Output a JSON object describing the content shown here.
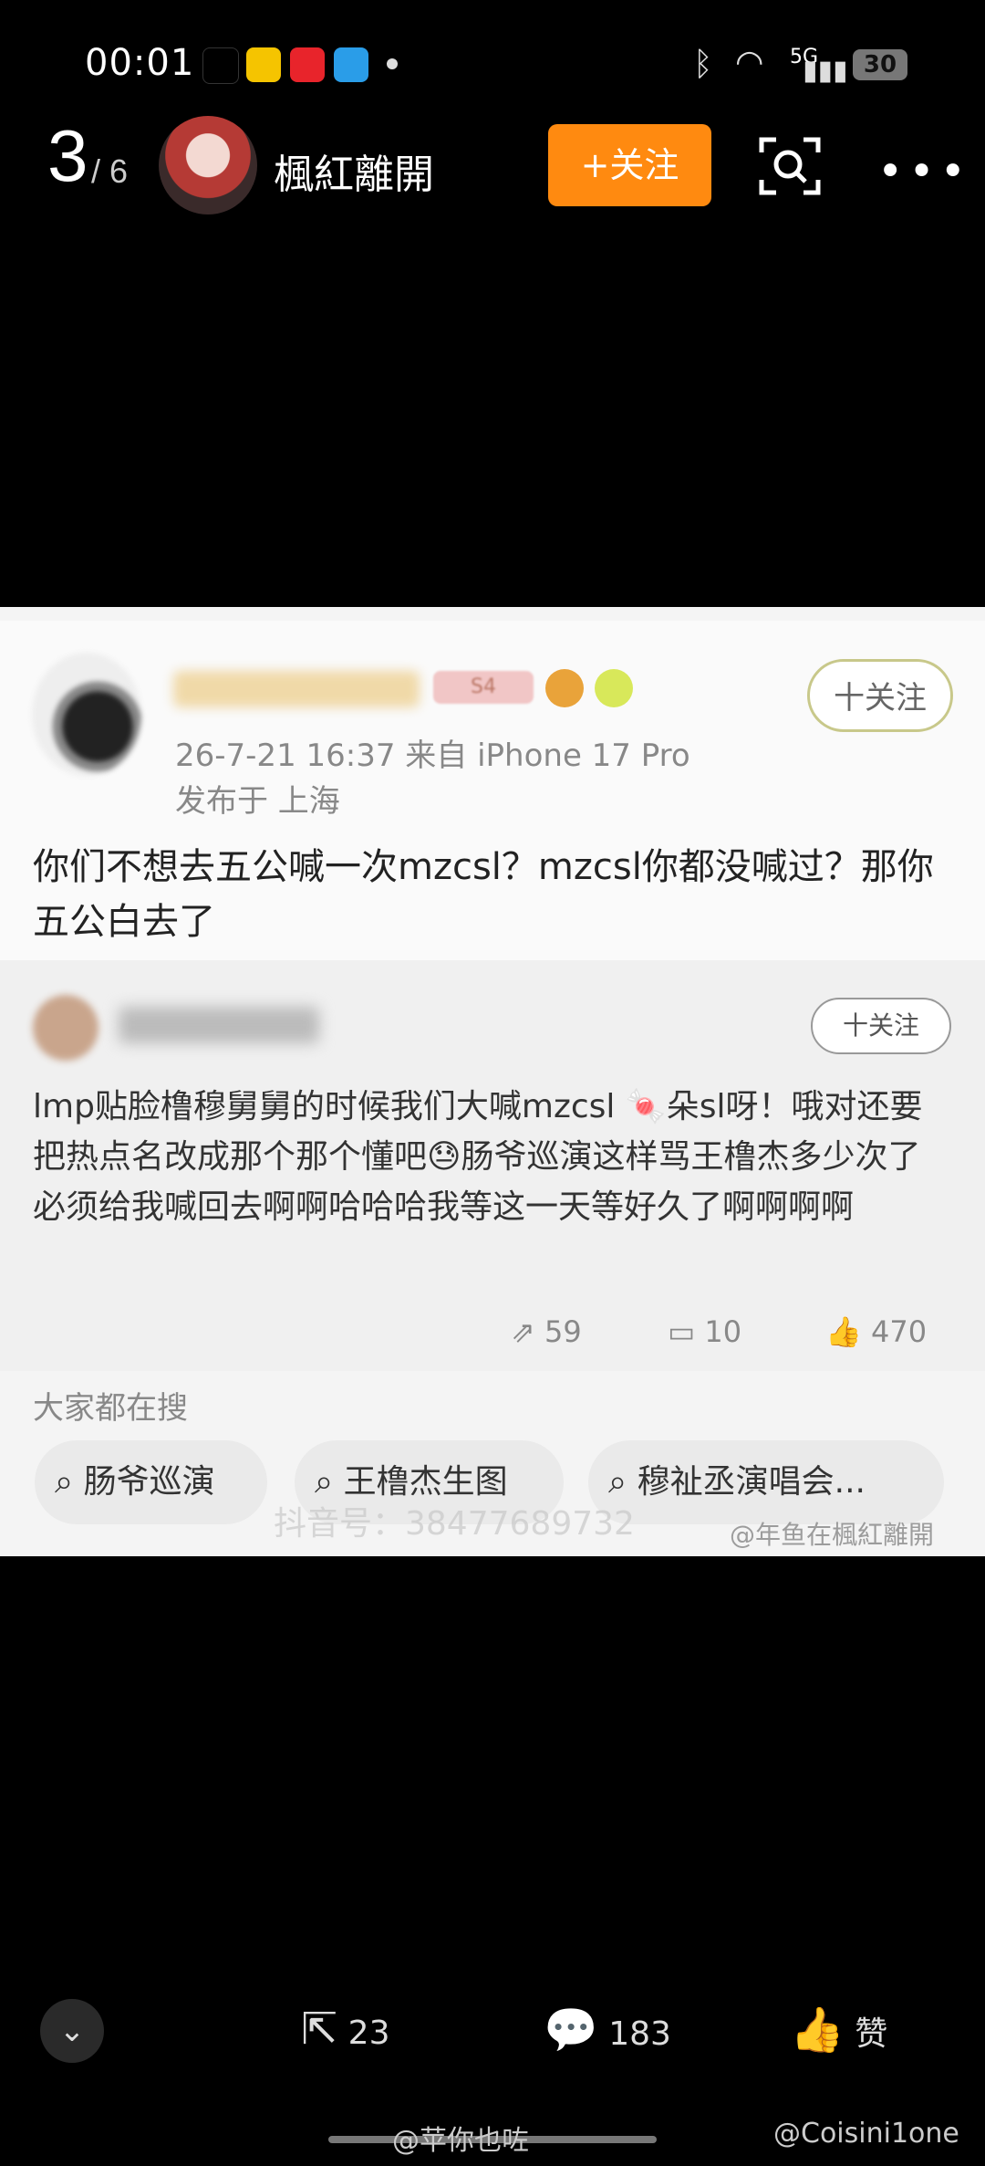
{
  "status_bar": {
    "time": "00:01",
    "network": "5G",
    "battery": "30"
  },
  "header": {
    "page_current": "3",
    "page_total": "/ 6",
    "author": "楓紅離開",
    "follow_label": "+关注"
  },
  "post": {
    "meta_line1": "26-7-21 16:37  来自 iPhone 17 Pro",
    "meta_line2": "发布于 上海",
    "follow_label": "十关注",
    "text": "你们不想去五公喊一次mzcsl？mzcsl你都没喊过？那你五公白去了",
    "badge": "S4"
  },
  "reply": {
    "follow_label": "十关注",
    "text": "lmp贴脸橹穆舅舅的时候我们大喊mzcsl 🍬朵sl呀！哦对还要把热点名改成那个那个懂吧😓肠爷巡演这样骂王橹杰多少次了 必须给我喊回去啊啊哈哈哈我等这一天等好久了啊啊啊啊",
    "reposts": "59",
    "comments": "10",
    "likes": "470"
  },
  "search": {
    "heading": "大家都在搜",
    "chips": [
      "肠爷巡演",
      "王橹杰生图",
      "穆祉丞演唱会..."
    ]
  },
  "watermarks": {
    "douyin": "抖音号：38477689732",
    "weibo_card": "@年鱼在楓紅離開",
    "bottom_left": "@苹你也咗",
    "bottom_right": "@Coisini1one"
  },
  "bottom_bar": {
    "share_count": "23",
    "comment_count": "183",
    "like_label": "赞"
  },
  "colors": {
    "follow_orange": "#ff8a10",
    "background": "#000000"
  }
}
